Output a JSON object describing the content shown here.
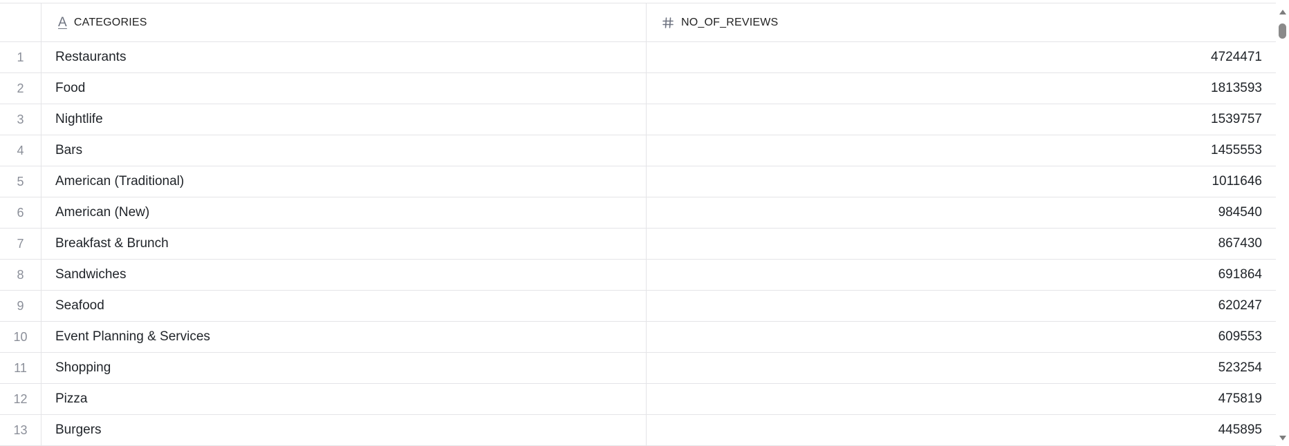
{
  "columns": {
    "categories": {
      "label": "CATEGORIES",
      "type_icon": "text-type-icon"
    },
    "no_of_reviews": {
      "label": "NO_OF_REVIEWS",
      "type_icon": "number-type-icon"
    }
  },
  "rows": [
    {
      "index": "1",
      "category": "Restaurants",
      "reviews": "4724471"
    },
    {
      "index": "2",
      "category": "Food",
      "reviews": "1813593"
    },
    {
      "index": "3",
      "category": "Nightlife",
      "reviews": "1539757"
    },
    {
      "index": "4",
      "category": "Bars",
      "reviews": "1455553"
    },
    {
      "index": "5",
      "category": "American (Traditional)",
      "reviews": "1011646"
    },
    {
      "index": "6",
      "category": "American (New)",
      "reviews": "984540"
    },
    {
      "index": "7",
      "category": "Breakfast & Brunch",
      "reviews": "867430"
    },
    {
      "index": "8",
      "category": "Sandwiches",
      "reviews": "691864"
    },
    {
      "index": "9",
      "category": "Seafood",
      "reviews": "620247"
    },
    {
      "index": "10",
      "category": "Event Planning & Services",
      "reviews": "609553"
    },
    {
      "index": "11",
      "category": "Shopping",
      "reviews": "523254"
    },
    {
      "index": "12",
      "category": "Pizza",
      "reviews": "475819"
    },
    {
      "index": "13",
      "category": "Burgers",
      "reviews": "445895"
    }
  ],
  "colors": {
    "grid_line": "#e4e4e7",
    "index_text": "#8b8f99",
    "cell_text": "#1f2328",
    "scrollbar_thumb": "#8a8a8a"
  }
}
